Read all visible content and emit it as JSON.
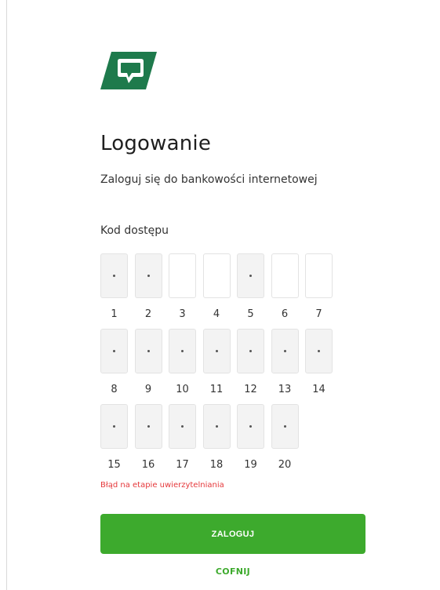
{
  "brand": {
    "logo_icon": "bank-shield-logo-icon",
    "logo_color": "#1e7a4c",
    "accent_color": "#3daa2d",
    "error_color": "#e5383b"
  },
  "login": {
    "title": "Logowanie",
    "subtitle": "Zaloguj się do bankowości internetowej",
    "code_label": "Kod dostępu",
    "pin_fields": [
      {
        "number": "1",
        "masked": true
      },
      {
        "number": "2",
        "masked": true
      },
      {
        "number": "3",
        "masked": false
      },
      {
        "number": "4",
        "masked": false
      },
      {
        "number": "5",
        "masked": true
      },
      {
        "number": "6",
        "masked": false
      },
      {
        "number": "7",
        "masked": false
      },
      {
        "number": "8",
        "masked": true
      },
      {
        "number": "9",
        "masked": true
      },
      {
        "number": "10",
        "masked": true
      },
      {
        "number": "11",
        "masked": true
      },
      {
        "number": "12",
        "masked": true
      },
      {
        "number": "13",
        "masked": true
      },
      {
        "number": "14",
        "masked": true
      },
      {
        "number": "15",
        "masked": true
      },
      {
        "number": "16",
        "masked": true
      },
      {
        "number": "17",
        "masked": true
      },
      {
        "number": "18",
        "masked": true
      },
      {
        "number": "19",
        "masked": true
      },
      {
        "number": "20",
        "masked": true
      }
    ],
    "error_message": "Błąd na etapie uwierzytelniania",
    "login_button": "ZALOGUJ",
    "back_link": "COFNIJ"
  }
}
